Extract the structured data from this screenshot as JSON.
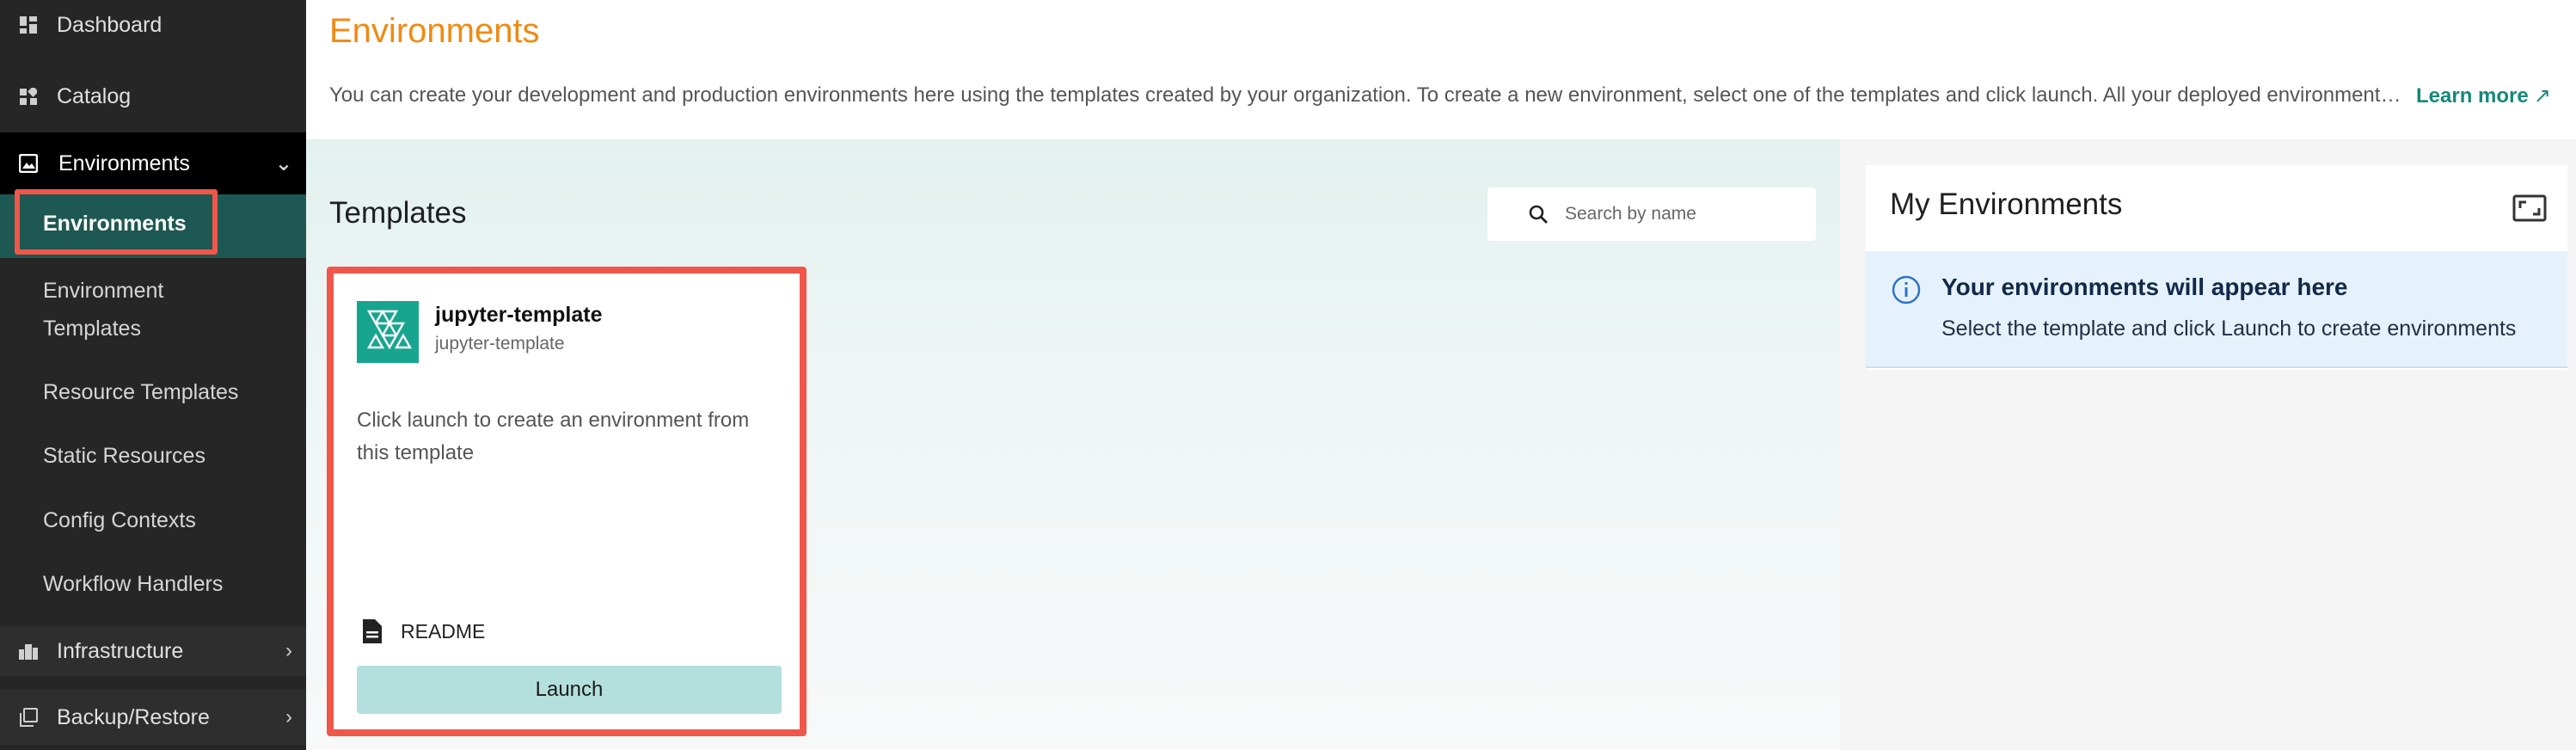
{
  "sidebar": {
    "items": [
      {
        "label": "Dashboard",
        "icon": "dashboard-icon"
      },
      {
        "label": "Catalog",
        "icon": "catalog-icon"
      },
      {
        "label": "Environments",
        "icon": "image-icon",
        "expanded": true
      }
    ],
    "sub_items": [
      "Environments",
      "Environment Templates",
      "Resource Templates",
      "Static Resources",
      "Config Contexts",
      "Workflow Handlers"
    ],
    "sub_env_templates_line1": "Environment",
    "sub_env_templates_line2": "Templates",
    "infrastructure": "Infrastructure",
    "backup": "Backup/Restore"
  },
  "header": {
    "title": "Environments",
    "description": "You can create your development and production environments here using the templates created by your organization. To create a new environment, select one of the templates and click launch. All your deployed environments will appear here.",
    "learn_more": "Learn more",
    "learn_more_icon": "↗"
  },
  "templates": {
    "title": "Templates",
    "search_placeholder": "Search by name",
    "cards": [
      {
        "name": "jupyter-template",
        "subtitle": "jupyter-template",
        "description": "Click launch to create an environment from this template",
        "readme_label": "README",
        "launch_label": "Launch"
      }
    ]
  },
  "my_environments": {
    "title": "My Environments",
    "info_title": "Your environments will appear here",
    "info_text": "Select the template and click Launch to create environments"
  },
  "colors": {
    "accent_orange": "#f08a12",
    "teal": "#14897a",
    "highlight_red": "#f0564a",
    "sidebar_bg": "#262626",
    "active_sub_bg": "#1e5852"
  }
}
